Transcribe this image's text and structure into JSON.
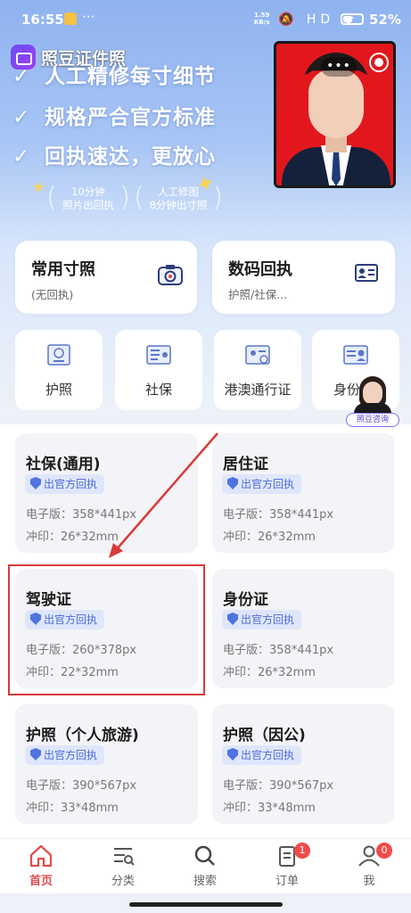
{
  "status_bar": {
    "time": "16:55",
    "more": "···",
    "speed_value": "1.59",
    "speed_unit": "KB/s",
    "icons": "🔕 HD ᯤ",
    "battery": "52%",
    "battery_level": 0.52
  },
  "app": {
    "name": "照豆证件照"
  },
  "hero": {
    "slogans": [
      "人工精修每寸细节",
      "规格严合官方标准",
      "回执速达，更放心"
    ],
    "check_glyph": "✓",
    "pill1": {
      "line1": "10分钟",
      "line2": "照片出回执"
    },
    "pill2": {
      "line1": "人工修图",
      "line2": "8分钟出寸照"
    }
  },
  "quick_cards": [
    {
      "title": "常用寸照",
      "subtitle": "(无回执)",
      "icon": "camera-icon"
    },
    {
      "title": "数码回执",
      "subtitle": "护照/社保...",
      "icon": "id-card-icon"
    }
  ],
  "categories": [
    {
      "label": "护照",
      "icon": "passport-icon"
    },
    {
      "label": "社保",
      "icon": "social-card-icon"
    },
    {
      "label": "港澳通行证",
      "icon": "travel-permit-icon"
    },
    {
      "label": "身份",
      "icon": "id-card-icon"
    }
  ],
  "consult": {
    "label": "照豆咨询"
  },
  "items": [
    {
      "title": "社保(通用)",
      "badge": "出官方回执",
      "line1": "电子版：358*441px",
      "line2": "冲印：26*32mm"
    },
    {
      "title": "居住证",
      "badge": "出官方回执",
      "line1": "电子版：358*441px",
      "line2": "冲印：26*32mm"
    },
    {
      "title": "驾驶证",
      "badge": "出官方回执",
      "line1": "电子版：260*378px",
      "line2": "冲印：22*32mm"
    },
    {
      "title": "身份证",
      "badge": "出官方回执",
      "line1": "电子版：358*441px",
      "line2": "冲印：26*32mm"
    },
    {
      "title": "护照（个人旅游)",
      "badge": "出官方回执",
      "line1": "电子版：390*567px",
      "line2": "冲印：33*48mm"
    },
    {
      "title": "护照（因公)",
      "badge": "出官方回执",
      "line1": "电子版：390*567px",
      "line2": "冲印：33*48mm"
    }
  ],
  "tabs": [
    {
      "label": "首页",
      "icon": "home-icon",
      "active": true
    },
    {
      "label": "分类",
      "icon": "category-icon"
    },
    {
      "label": "搜索",
      "icon": "search-icon"
    },
    {
      "label": "订单",
      "icon": "order-icon",
      "badge": "1"
    },
    {
      "label": "我",
      "icon": "user-icon",
      "badge": "0"
    }
  ],
  "colors": {
    "accent": "#e24b4b",
    "badge_text": "#4c6bd8",
    "badge_bg": "#dfe6fb",
    "photo_bg": "#e1171d",
    "annotation": "#d83a3a"
  }
}
